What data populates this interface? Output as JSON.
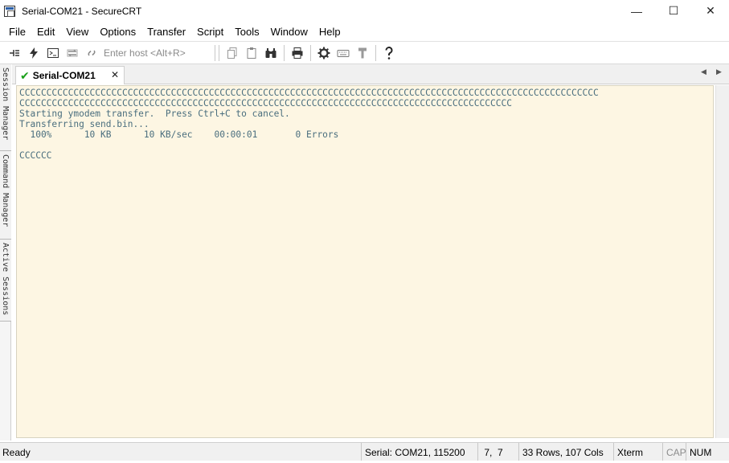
{
  "window": {
    "title": "Serial-COM21 - SecureCRT",
    "minimize": "—",
    "maximize": "☐",
    "close": "✕"
  },
  "menu": [
    "File",
    "Edit",
    "View",
    "Options",
    "Transfer",
    "Script",
    "Tools",
    "Window",
    "Help"
  ],
  "toolbar": {
    "host_placeholder": "Enter host <Alt+R>"
  },
  "dock_tabs": [
    "Session Manager",
    "Command Manager",
    "Active Sessions"
  ],
  "tab": {
    "label": "Serial-COM21",
    "close": "✕",
    "scroll_left": "◀",
    "scroll_right": "▶"
  },
  "terminal": {
    "lines": [
      "CCCCCCCCCCCCCCCCCCCCCCCCCCCCCCCCCCCCCCCCCCCCCCCCCCCCCCCCCCCCCCCCCCCCCCCCCCCCCCCCCCCCCCCCCCCCCCCCCCCCCCCCCCC",
      "CCCCCCCCCCCCCCCCCCCCCCCCCCCCCCCCCCCCCCCCCCCCCCCCCCCCCCCCCCCCCCCCCCCCCCCCCCCCCCCCCCCCCCCCCCC",
      "Starting ymodem transfer.  Press Ctrl+C to cancel.",
      "Transferring send.bin...",
      "  100%      10 KB      10 KB/sec    00:00:01       0 Errors",
      "",
      "CCCCCC"
    ]
  },
  "status": {
    "ready": "Ready",
    "connection": "Serial: COM21, 115200",
    "cursor": " 7,  7",
    "size": "33 Rows, 107 Cols",
    "term_type": "Xterm",
    "cap": "CAP",
    "num": "NUM"
  }
}
